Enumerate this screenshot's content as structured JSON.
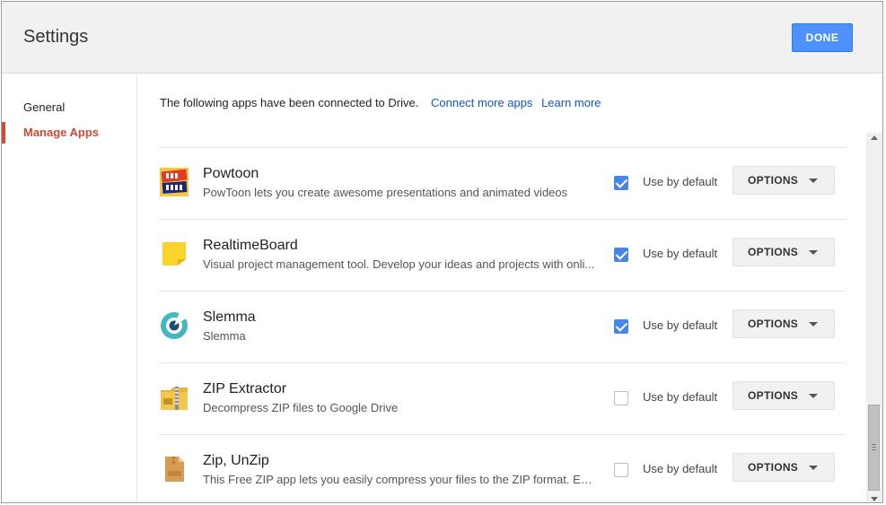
{
  "header": {
    "title": "Settings",
    "done_label": "DONE"
  },
  "sidebar": {
    "items": [
      {
        "label": "General",
        "active": false
      },
      {
        "label": "Manage Apps",
        "active": true
      }
    ]
  },
  "main": {
    "intro_text": "The following apps have been connected to Drive.",
    "connect_link": "Connect more apps",
    "learn_link": "Learn more",
    "use_default_label": "Use by default",
    "options_label": "OPTIONS",
    "apps": [
      {
        "name": "Powtoon",
        "description": "PowToon lets you create awesome presentations and animated videos",
        "use_by_default": true,
        "icon": "powtoon-icon"
      },
      {
        "name": "RealtimeBoard",
        "description": "Visual project management tool. Develop your ideas and projects with onli...",
        "use_by_default": true,
        "icon": "realtimeboard-icon"
      },
      {
        "name": "Slemma",
        "description": "Slemma",
        "use_by_default": true,
        "icon": "slemma-icon"
      },
      {
        "name": "ZIP Extractor",
        "description": "Decompress ZIP files to Google Drive",
        "use_by_default": false,
        "icon": "zip-extractor-icon"
      },
      {
        "name": "Zip, UnZip",
        "description": "This Free ZIP app lets you easily compress your files to the ZIP format. Ext...",
        "use_by_default": false,
        "icon": "zip-unzip-icon"
      }
    ]
  },
  "colors": {
    "accent": "#4d90fe",
    "active_nav": "#d14836",
    "link": "#1155cc",
    "checkbox_on": "#4a86e8"
  }
}
